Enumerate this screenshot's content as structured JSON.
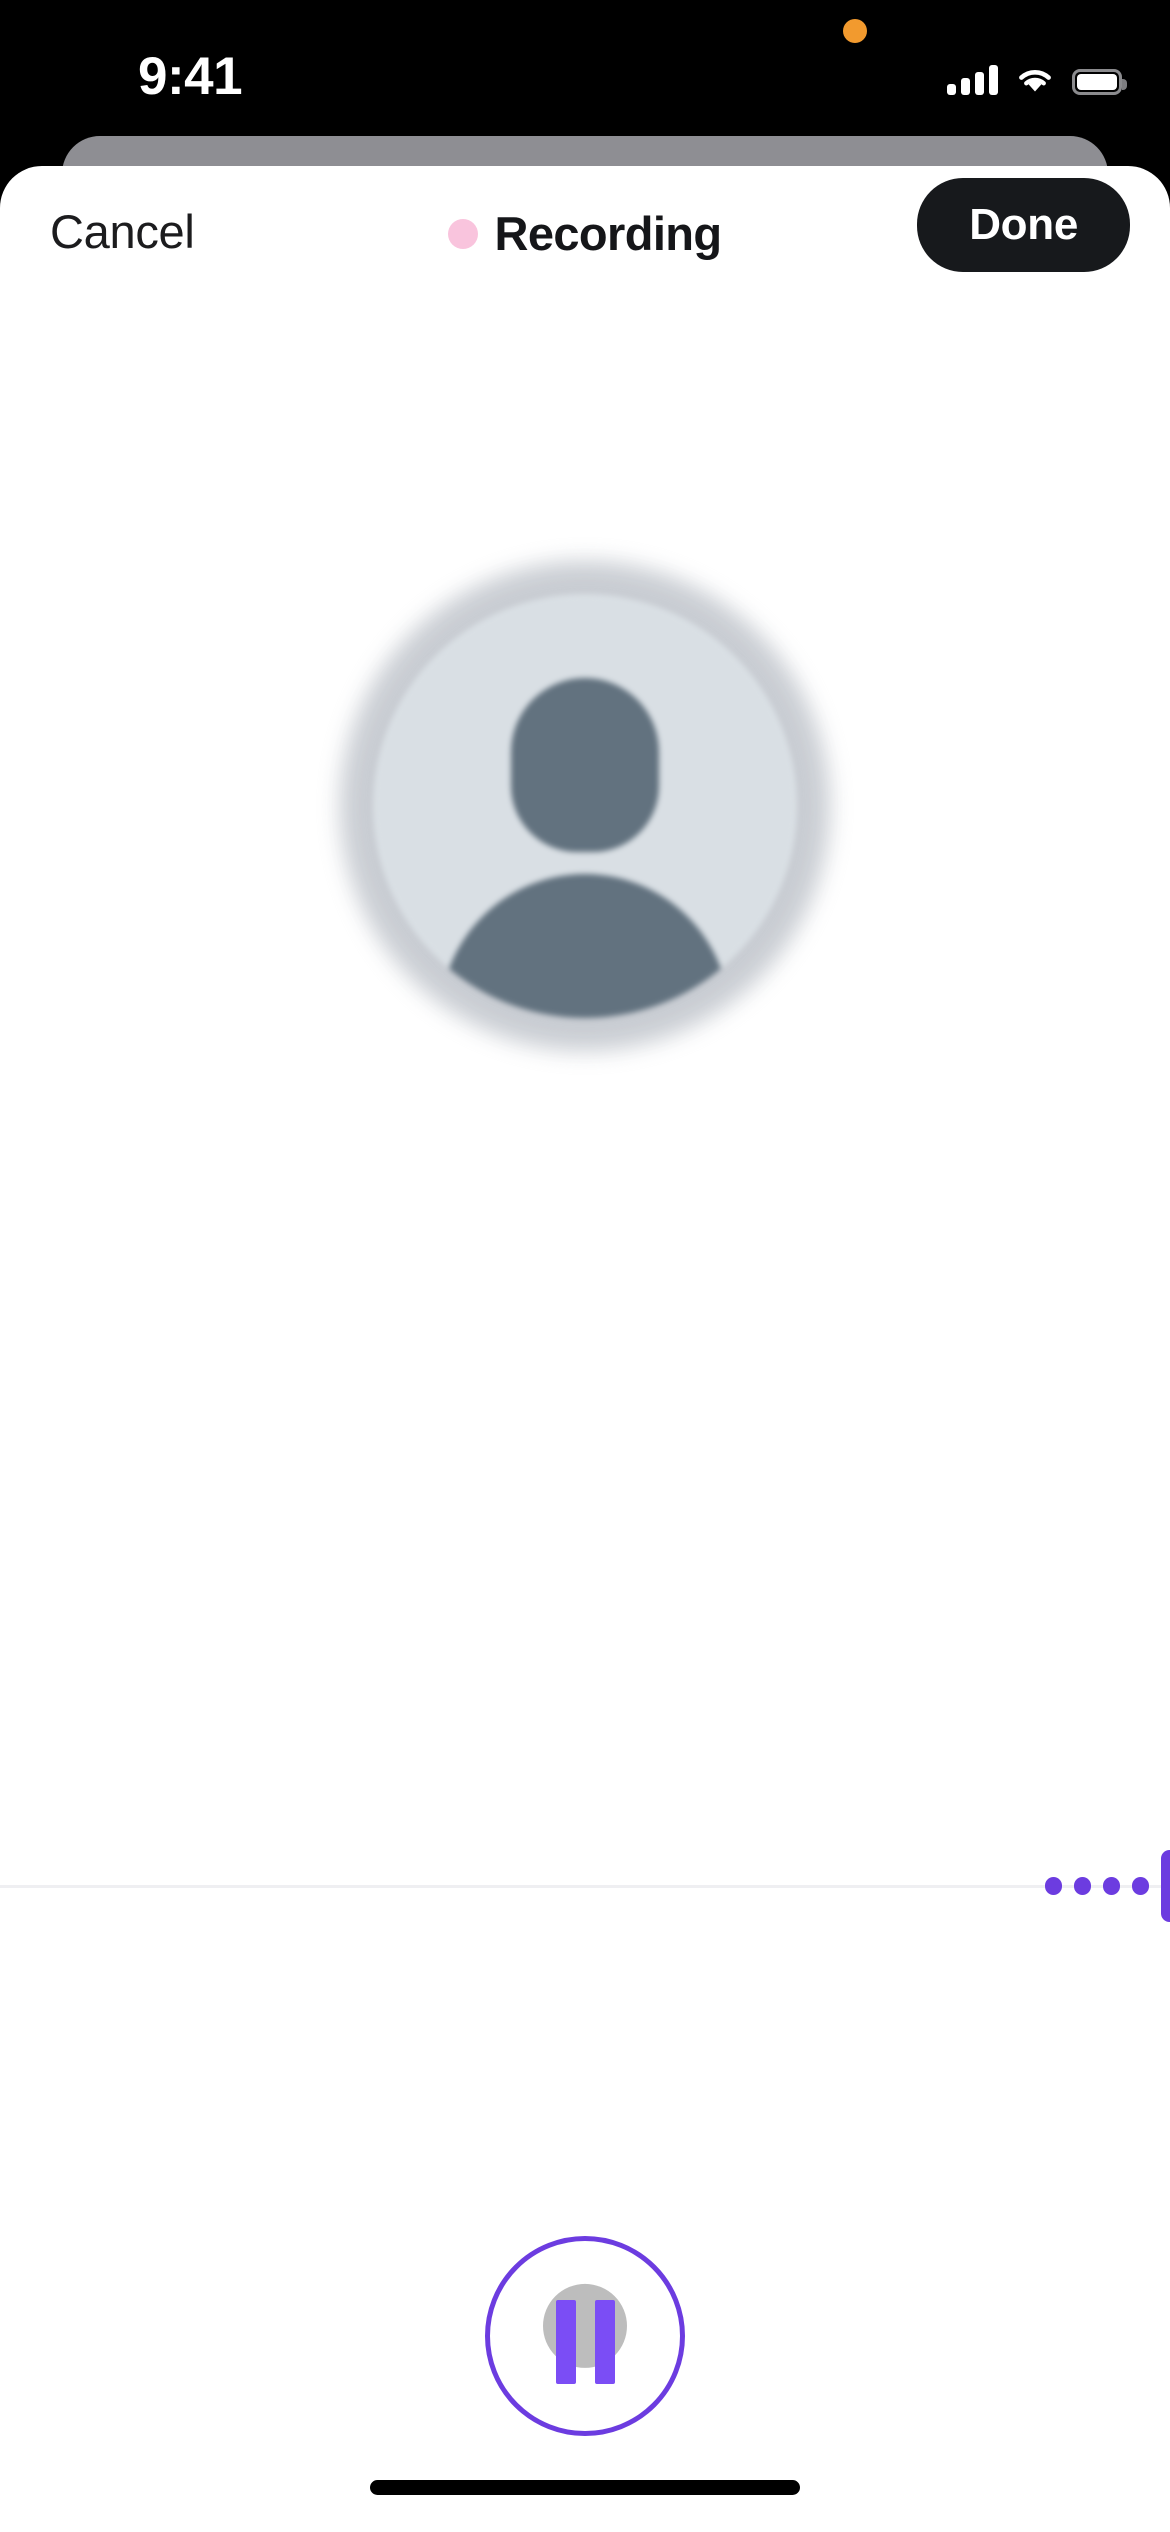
{
  "status_bar": {
    "time": "9:41",
    "mic_indicator_icon": "microphone-in-use-dot",
    "mic_indicator_color": "#F29A2E",
    "cellular_icon": "cellular-signal-icon",
    "wifi_icon": "wifi-icon",
    "battery_icon": "battery-full-icon"
  },
  "sheet": {
    "header": {
      "cancel_label": "Cancel",
      "title": "Recording",
      "recording_dot_icon": "recording-status-dot",
      "recording_dot_color": "#F9C4DD",
      "done_label": "Done",
      "done_background": "#17191C"
    },
    "avatar": {
      "icon": "person-placeholder-avatar",
      "background_color": "#D9DFE4",
      "figure_color": "#62727F"
    },
    "waveform": {
      "baseline_color": "#EFEFF2",
      "bar_color": "#6C3CE0",
      "bars": [
        18,
        18,
        18,
        18,
        72
      ]
    },
    "record_button": {
      "icon": "pause-icon",
      "ring_color": "#6C3CE0",
      "bar_color": "#7B4DF5",
      "orb_color": "#AAAAAA",
      "state": "recording"
    }
  },
  "home_indicator": {
    "label": "home-indicator"
  }
}
